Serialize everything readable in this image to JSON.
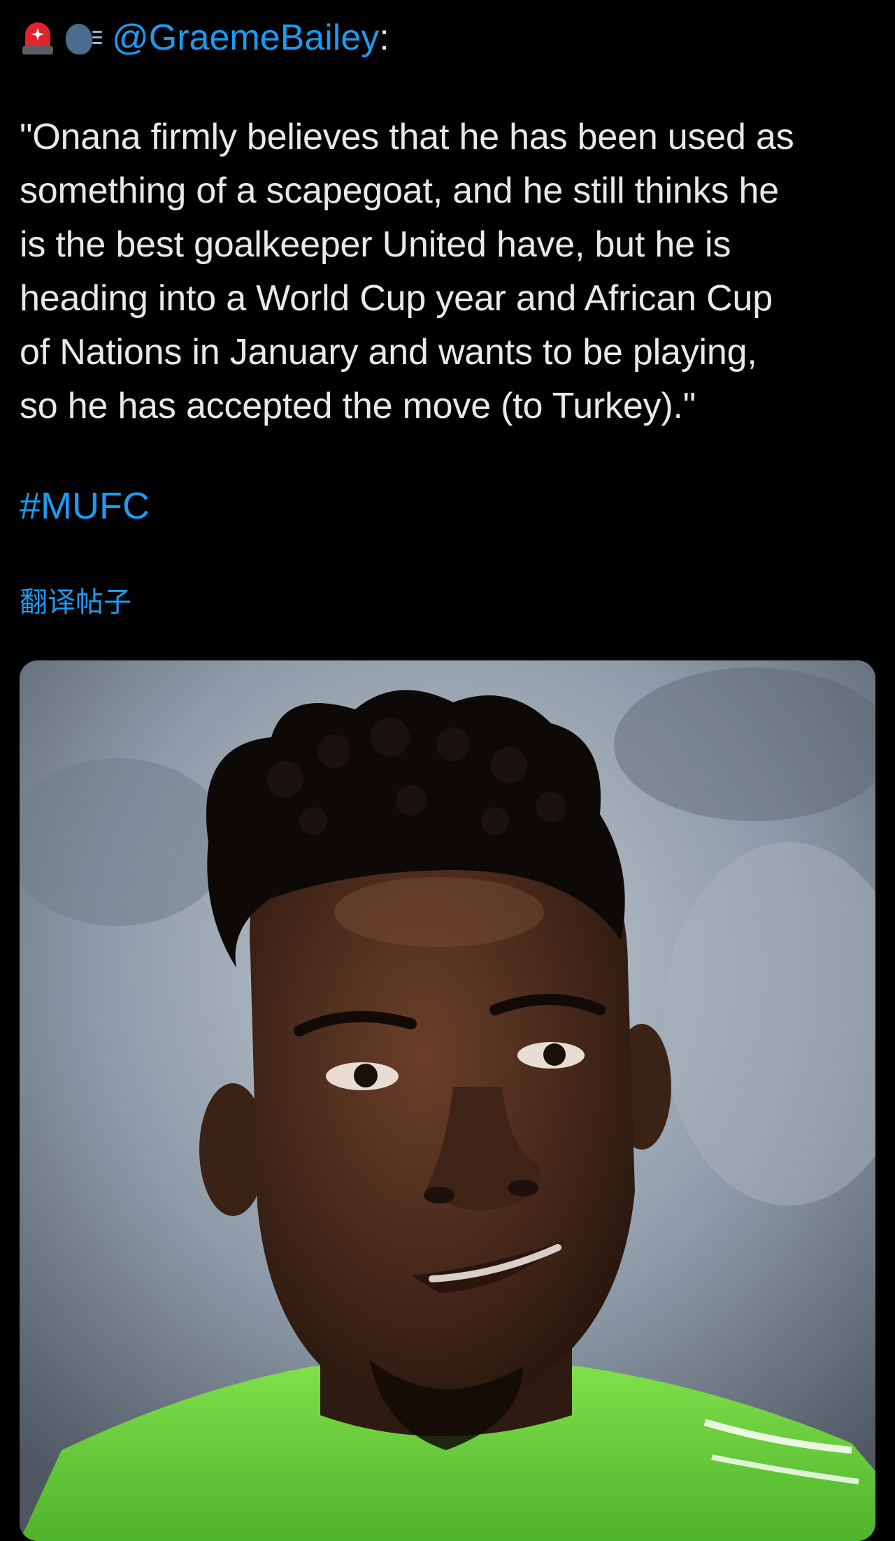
{
  "post": {
    "emojis": [
      "rotating-light-icon",
      "speaking-head-icon"
    ],
    "handle": "@GraemeBailey",
    "colon": ":",
    "quote": "\"Onana firmly believes that he has been used as\nsomething of a scapegoat, and he still thinks he\nis the best goalkeeper United have, but he is\nheading into a World Cup year and African Cup\nof Nations in January and wants to be playing,\nso he has accepted the move (to Turkey).\"",
    "hashtag": "#MUFC",
    "translate_label": "翻译帖子"
  },
  "colors": {
    "background": "#000000",
    "text": "#e7e9ea",
    "link": "#1d9bf0"
  }
}
